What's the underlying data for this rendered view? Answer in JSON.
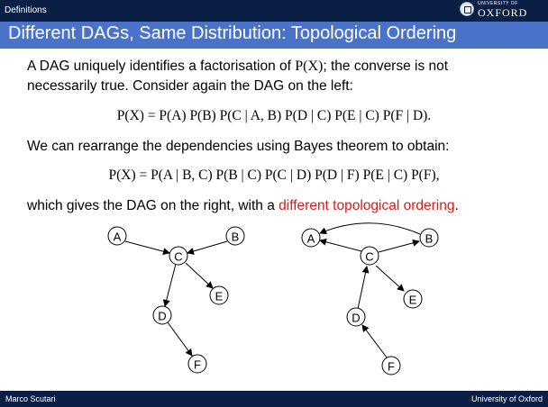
{
  "header": {
    "section": "Definitions",
    "logo_top": "UNIVERSITY OF",
    "logo_name": "OXFORD"
  },
  "slide": {
    "title": "Different DAGs, Same Distribution: Topological Ordering",
    "para1_line1_a": "A DAG uniquely identifies a factorisation of ",
    "para1_line1_math": "P(X)",
    "para1_line1_b": "; the converse is not",
    "para1_line2": "necessarily true.  Consider again the DAG on the left:",
    "equation1": "P(X) = P(A) P(B) P(C | A, B) P(D | C) P(E | C) P(F | D).",
    "para2": "We can rearrange the dependencies using Bayes theorem to obtain:",
    "equation2": "P(X) = P(A | B, C) P(B | C) P(C | D) P(D | F) P(E | C) P(F),",
    "para3_a": "which gives the DAG on the right, with a ",
    "para3_highlight": "different topological ordering",
    "para3_b": "."
  },
  "graphs": {
    "node_labels": [
      "A",
      "B",
      "C",
      "D",
      "E",
      "F"
    ]
  },
  "footer": {
    "author": "Marco Scutari",
    "institution": "University of Oxford"
  },
  "colors": {
    "header_bg": "#0b1f45",
    "title_bg": "#4a72c9",
    "highlight": "#e01818"
  }
}
